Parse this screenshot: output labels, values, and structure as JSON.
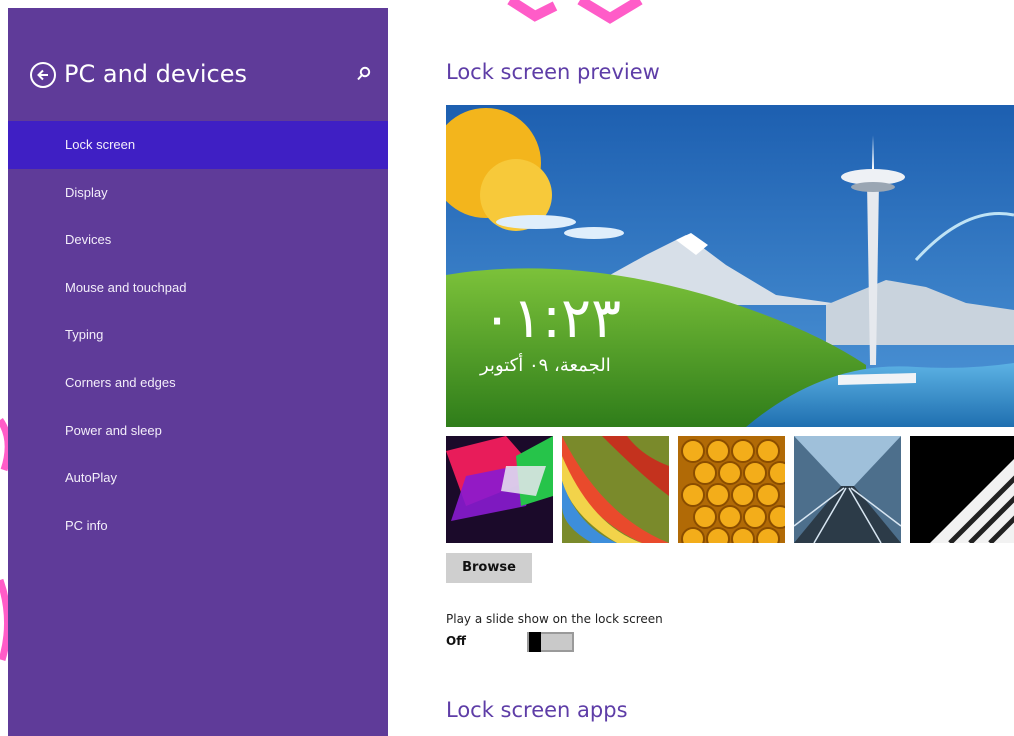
{
  "sidebar": {
    "title": "PC and devices",
    "back_icon": "back-arrow-circle-icon",
    "search_icon": "search-icon",
    "items": [
      {
        "label": "Lock screen",
        "active": true
      },
      {
        "label": "Display",
        "active": false
      },
      {
        "label": "Devices",
        "active": false
      },
      {
        "label": "Mouse and touchpad",
        "active": false
      },
      {
        "label": "Typing",
        "active": false
      },
      {
        "label": "Corners and edges",
        "active": false
      },
      {
        "label": "Power and sleep",
        "active": false
      },
      {
        "label": "AutoPlay",
        "active": false
      },
      {
        "label": "PC info",
        "active": false
      }
    ]
  },
  "main": {
    "preview_title": "Lock screen preview",
    "preview": {
      "clock": "٠١:٢٣",
      "date": "الجمعة، ٠٩ أكتوبر"
    },
    "browse_label": "Browse",
    "slideshow": {
      "label": "Play a slide show on the lock screen",
      "state": "Off",
      "on": false
    },
    "apps_title": "Lock screen apps"
  },
  "colors": {
    "sidebar_bg": "#5f3b99",
    "active_item_bg": "#3f1fc4",
    "heading": "#5e3da7"
  }
}
